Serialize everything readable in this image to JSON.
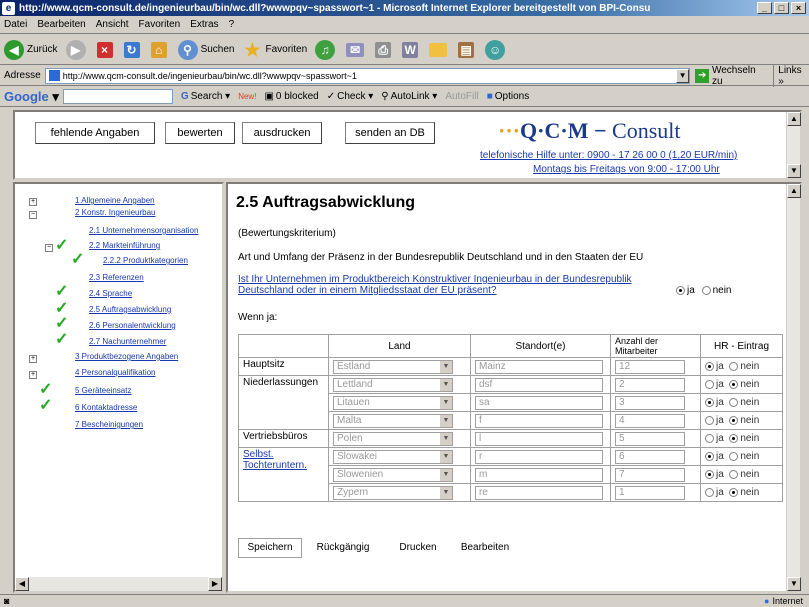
{
  "window": {
    "title": "http://www.qcm-consult.de/ingenieurbau/bin/wc.dll?wwwpqv~spasswort~1 - Microsoft Internet Explorer bereitgestellt von BPI-Consu"
  },
  "menu": [
    "Datei",
    "Bearbeiten",
    "Ansicht",
    "Favoriten",
    "Extras",
    "?"
  ],
  "toolbar": {
    "back": "Zurück",
    "search": "Suchen",
    "favorites": "Favoriten"
  },
  "address": {
    "label": "Adresse",
    "url": "http://www.qcm-consult.de/ingenieurbau/bin/wc.dll?wwwpqv~spasswort~1",
    "go": "Wechseln zu",
    "links": "Links »"
  },
  "googlebar": {
    "logo": "Google",
    "search": "Search",
    "new": "New!",
    "blocked": "0 blocked",
    "check": "Check",
    "autolink": "AutoLink",
    "autofill": "AutoFill",
    "options": "Options"
  },
  "top": {
    "buttons": {
      "missing": "fehlende Angaben",
      "rate": "bewerten",
      "print": "ausdrucken",
      "send": "senden an DB"
    },
    "logo": {
      "dots": "···",
      "text": "Q·C·M",
      "dash": "−",
      "consult": "Consult"
    },
    "help1": "telefonische Hilfe unter: 0900 - 17 26 00 0 (1,20 EUR/min)",
    "help2": "Montags bis Freitags von 9:00 - 17:00 Uhr"
  },
  "tree": [
    {
      "label": "1 Allgemeine Angaben"
    },
    {
      "label": "2 Konstr. Ingenieurbau"
    },
    {
      "label": "2.1 Unternehmensorganisation"
    },
    {
      "label": "2.2 Markteinführung"
    },
    {
      "label": "2.2.2 Produktkategorien"
    },
    {
      "label": "2.3 Referenzen"
    },
    {
      "label": "2.4 Sprache"
    },
    {
      "label": "2.5 Auftragsabwicklung"
    },
    {
      "label": "2.6 Personalentwicklung"
    },
    {
      "label": "2.7 Nachunternehmer"
    },
    {
      "label": "3 Produktbezogene Angaben"
    },
    {
      "label": "4 Personalqualifikation"
    },
    {
      "label": "5 Geräteeinsatz"
    },
    {
      "label": "6 Kontaktadresse"
    },
    {
      "label": "7 Bescheinigungen"
    }
  ],
  "main": {
    "heading": "2.5 Auftragsabwicklung",
    "criterion": "(Bewertungskriterium)",
    "description": "Art und Umfang der Präsenz in der Bundesrepublik Deutschland und in den Staaten der EU",
    "question_line1": "Ist Ihr Unternehmen im Produktbereich Konstruktiver Ingenieurbau in der Bundesrepublik",
    "question_line2": "Deutschland oder in einem Mitgliedsstaat der EU präsent?",
    "yes": "ja",
    "no": "nein",
    "if_yes": "Wenn ja:",
    "columns": [
      "",
      "Land",
      "Standort(e)",
      "Anzahl der Mitarbeiter",
      "HR - Eintrag"
    ],
    "rows": [
      {
        "group": "Hauptsitz",
        "land": "Estland",
        "standort": "Mainz",
        "anzahl": "12",
        "hr": "ja"
      },
      {
        "group": "Niederlassungen",
        "land": "Lettland",
        "standort": "dsf",
        "anzahl": "2",
        "hr": "nein"
      },
      {
        "group": "",
        "land": "Litauen",
        "standort": "sa",
        "anzahl": "3",
        "hr": "ja"
      },
      {
        "group": "",
        "land": "Malta",
        "standort": "f",
        "anzahl": "4",
        "hr": "nein"
      },
      {
        "group": "Vertriebsbüros",
        "land": "Polen",
        "standort": "l",
        "anzahl": "5",
        "hr": "nein"
      },
      {
        "group": "Selbst. Tochteruntern.",
        "land": "Slowakei",
        "standort": "r",
        "anzahl": "6",
        "hr": "ja"
      },
      {
        "group": "",
        "land": "Slowenien",
        "standort": "m",
        "anzahl": "7",
        "hr": "ja"
      },
      {
        "group": "",
        "land": "Zypern",
        "standort": "re",
        "anzahl": "1",
        "hr": "nein"
      }
    ],
    "buttons": {
      "save": "Speichern",
      "undo": "Rückgängig",
      "print": "Drucken",
      "edit": "Bearbeiten"
    }
  },
  "status": {
    "zone": "Internet"
  }
}
